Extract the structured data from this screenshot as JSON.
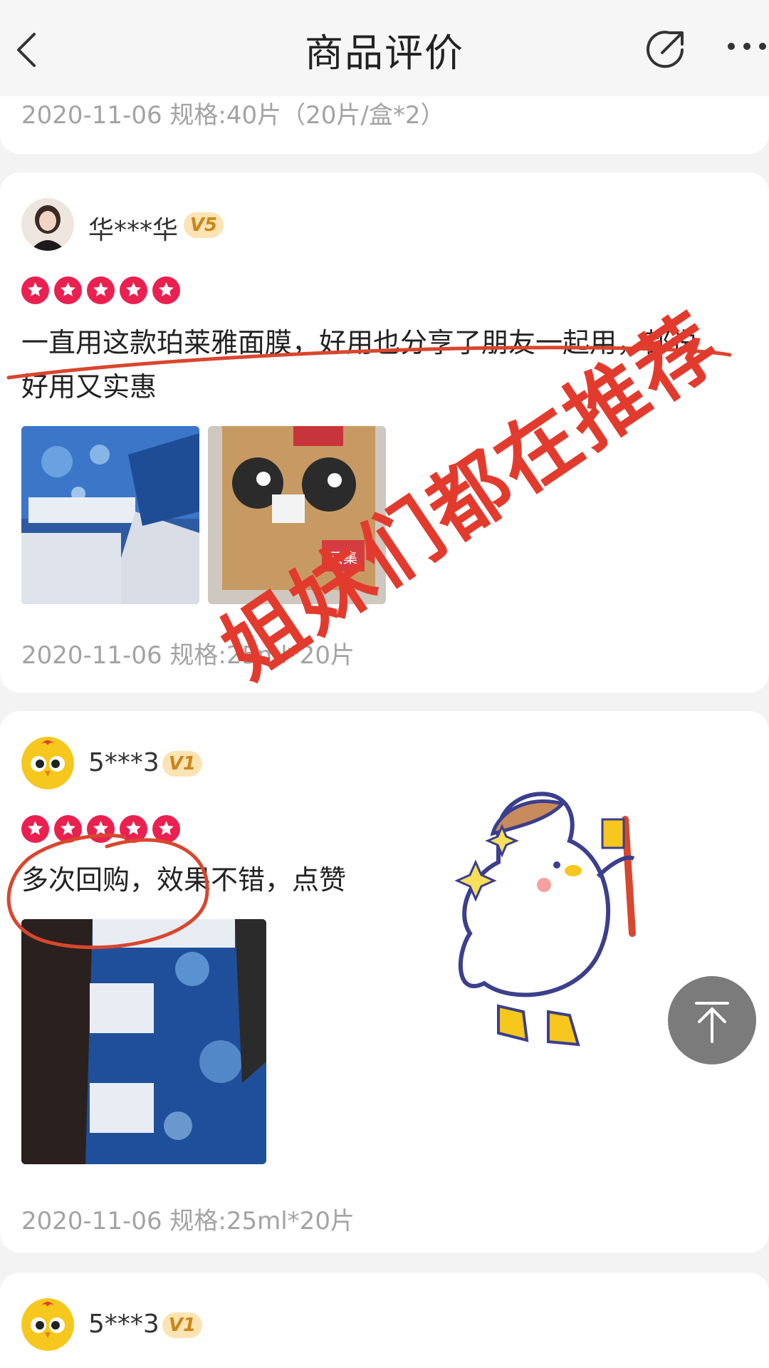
{
  "header": {
    "title": "商品评价",
    "back_icon": "chevron-left-icon",
    "share_icon": "share-icon",
    "more_icon": "more-dots-icon"
  },
  "top_card": {
    "meta": "2020-11-06 规格:40片（20片/盒*2）"
  },
  "reviews": [
    {
      "username": "华***华",
      "vip_level": "V5",
      "rating": 5,
      "text_line1": "一直用这款珀莱雅面膜，好用也分享了朋友一起用，都说",
      "text_line2": "好用又实惠",
      "meta": "2020-11-06 规格:25ml*20片"
    },
    {
      "username": "5***3",
      "vip_level": "V1",
      "rating": 5,
      "text_line1": "多次回购，效果不错，点赞",
      "meta": "2020-11-06 规格:25ml*20片"
    },
    {
      "username": "5***3",
      "vip_level": "V1"
    }
  ],
  "box_label": "云集",
  "overlay_text": "姐妹们都在推荐",
  "colors": {
    "accent_red": "#ea2150",
    "annotation_red": "#d9462e",
    "badge_gold": "#fbe3b3",
    "scroll_button": "#7b7b7b"
  }
}
